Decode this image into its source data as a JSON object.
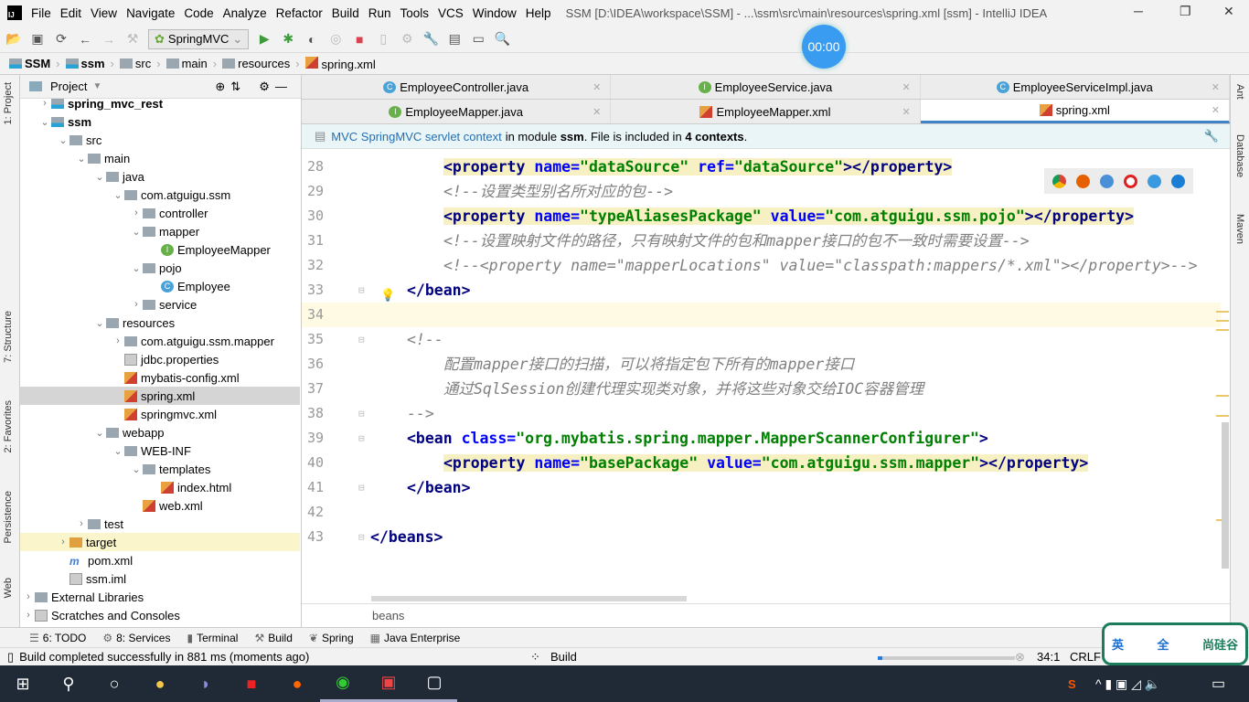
{
  "window": {
    "title": "SSM [D:\\IDEA\\workspace\\SSM] - ...\\ssm\\src\\main\\resources\\spring.xml [ssm] - IntelliJ IDEA",
    "logo": "IJ"
  },
  "menu": [
    "File",
    "Edit",
    "View",
    "Navigate",
    "Code",
    "Analyze",
    "Refactor",
    "Build",
    "Run",
    "Tools",
    "VCS",
    "Window",
    "Help"
  ],
  "toolbar": {
    "run_config": "SpringMVC",
    "timer": "00:00"
  },
  "breadcrumb": [
    "SSM",
    "ssm",
    "src",
    "main",
    "resources",
    "spring.xml"
  ],
  "left_strip": [
    "1: Project",
    "7: Structure",
    "2: Favorites",
    "Persistence",
    "Web"
  ],
  "right_strip": [
    "Ant",
    "Database",
    "Maven"
  ],
  "project": {
    "header": "Project",
    "tree": [
      {
        "label": "spring_mvc_rest",
        "level": 0,
        "icon": "module",
        "arrow": "right",
        "bold": true
      },
      {
        "label": "ssm",
        "level": 0,
        "icon": "module",
        "arrow": "down",
        "bold": true
      },
      {
        "label": "src",
        "level": 1,
        "icon": "folder",
        "arrow": "down"
      },
      {
        "label": "main",
        "level": 2,
        "icon": "folder",
        "arrow": "down"
      },
      {
        "label": "java",
        "level": 3,
        "icon": "src-folder",
        "arrow": "down"
      },
      {
        "label": "com.atguigu.ssm",
        "level": 4,
        "icon": "package",
        "arrow": "down"
      },
      {
        "label": "controller",
        "level": 5,
        "icon": "package",
        "arrow": "right"
      },
      {
        "label": "mapper",
        "level": 5,
        "icon": "package",
        "arrow": "down"
      },
      {
        "label": "EmployeeMapper",
        "level": 6,
        "icon": "interface"
      },
      {
        "label": "pojo",
        "level": 5,
        "icon": "package",
        "arrow": "down"
      },
      {
        "label": "Employee",
        "level": 6,
        "icon": "class"
      },
      {
        "label": "service",
        "level": 5,
        "icon": "package",
        "arrow": "right"
      },
      {
        "label": "resources",
        "level": 3,
        "icon": "res-folder",
        "arrow": "down"
      },
      {
        "label": "com.atguigu.ssm.mapper",
        "level": 4,
        "icon": "package",
        "arrow": "right"
      },
      {
        "label": "jdbc.properties",
        "level": 4,
        "icon": "file"
      },
      {
        "label": "mybatis-config.xml",
        "level": 4,
        "icon": "xml"
      },
      {
        "label": "spring.xml",
        "level": 4,
        "icon": "xml",
        "selected": true
      },
      {
        "label": "springmvc.xml",
        "level": 4,
        "icon": "xml"
      },
      {
        "label": "webapp",
        "level": 3,
        "icon": "folder",
        "arrow": "down"
      },
      {
        "label": "WEB-INF",
        "level": 4,
        "icon": "folder",
        "arrow": "down"
      },
      {
        "label": "templates",
        "level": 5,
        "icon": "folder",
        "arrow": "down"
      },
      {
        "label": "index.html",
        "level": 6,
        "icon": "html"
      },
      {
        "label": "web.xml",
        "level": 5,
        "icon": "xml"
      },
      {
        "label": "test",
        "level": 2,
        "icon": "folder",
        "arrow": "right"
      },
      {
        "label": "target",
        "level": 1,
        "icon": "folder-orange",
        "arrow": "right",
        "highlight": true
      },
      {
        "label": "pom.xml",
        "level": 1,
        "icon": "pom"
      },
      {
        "label": "ssm.iml",
        "level": 1,
        "icon": "file"
      },
      {
        "label": "External Libraries",
        "level": -1,
        "icon": "libs",
        "arrow": "right"
      },
      {
        "label": "Scratches and Consoles",
        "level": -1,
        "icon": "scratches",
        "arrow": "right"
      }
    ]
  },
  "tabs_row1": [
    {
      "label": "EmployeeController.java",
      "icon": "C"
    },
    {
      "label": "EmployeeService.java",
      "icon": "I"
    },
    {
      "label": "EmployeeServiceImpl.java",
      "icon": "C"
    }
  ],
  "tabs_row2": [
    {
      "label": "EmployeeMapper.java",
      "icon": "I"
    },
    {
      "label": "EmployeeMapper.xml",
      "icon": "xml"
    },
    {
      "label": "spring.xml",
      "icon": "xml",
      "active": true
    }
  ],
  "banner": {
    "link": "MVC SpringMVC servlet context",
    "t1": "in module",
    "module": "ssm",
    "t2": ". File is included in",
    "count": "4 contexts",
    "t3": "."
  },
  "code": [
    {
      "n": "28",
      "indent": 8,
      "tokens": [
        [
          "tag",
          "<property "
        ],
        [
          "attr",
          "name="
        ],
        [
          "val",
          "\"dataSource\" "
        ],
        [
          "attr",
          "ref="
        ],
        [
          "val",
          "\"dataSource\""
        ],
        [
          "tag",
          "></property>"
        ]
      ],
      "hl": true
    },
    {
      "n": "29",
      "indent": 8,
      "tokens": [
        [
          "com",
          "<!--设置类型别名所对应的包-->"
        ]
      ]
    },
    {
      "n": "30",
      "indent": 8,
      "tokens": [
        [
          "tag",
          "<property "
        ],
        [
          "attr",
          "name="
        ],
        [
          "val",
          "\"typeAliasesPackage\" "
        ],
        [
          "attr",
          "value="
        ],
        [
          "val",
          "\"com.atguigu.ssm.pojo\""
        ],
        [
          "tag",
          "></property>"
        ]
      ],
      "hl": true
    },
    {
      "n": "31",
      "indent": 8,
      "tokens": [
        [
          "com",
          "<!--设置映射文件的路径，只有映射文件的包和mapper接口的包不一致时需要设置-->"
        ]
      ]
    },
    {
      "n": "32",
      "indent": 8,
      "tokens": [
        [
          "com",
          "<!--<property name=\"mapperLocations\" value=\"classpath:mappers/*.xml\"></property>-->"
        ]
      ]
    },
    {
      "n": "33",
      "indent": 4,
      "tokens": [
        [
          "tag",
          "</bean>"
        ]
      ]
    },
    {
      "n": "34",
      "indent": 0,
      "tokens": [],
      "current": true
    },
    {
      "n": "35",
      "indent": 4,
      "tokens": [
        [
          "com",
          "<!--"
        ]
      ]
    },
    {
      "n": "36",
      "indent": 8,
      "tokens": [
        [
          "com",
          "配置mapper接口的扫描，可以将指定包下所有的mapper接口"
        ]
      ]
    },
    {
      "n": "37",
      "indent": 8,
      "tokens": [
        [
          "com",
          "通过SqlSession创建代理实现类对象，并将这些对象交给IOC容器管理"
        ]
      ]
    },
    {
      "n": "38",
      "indent": 4,
      "tokens": [
        [
          "com",
          "-->"
        ]
      ]
    },
    {
      "n": "39",
      "indent": 4,
      "tokens": [
        [
          "tag",
          "<bean "
        ],
        [
          "attr",
          "class="
        ],
        [
          "val",
          "\"org.mybatis.spring.mapper.MapperScannerConfigurer\""
        ],
        [
          "tag",
          ">"
        ]
      ]
    },
    {
      "n": "40",
      "indent": 8,
      "tokens": [
        [
          "tag",
          "<property "
        ],
        [
          "attr",
          "name="
        ],
        [
          "val",
          "\"basePackage\" "
        ],
        [
          "attr",
          "value="
        ],
        [
          "val",
          "\"com.atguigu.ssm.mapper\""
        ],
        [
          "tag",
          "></property>"
        ]
      ],
      "hl": true
    },
    {
      "n": "41",
      "indent": 4,
      "tokens": [
        [
          "tag",
          "</bean>"
        ]
      ]
    },
    {
      "n": "42",
      "indent": 0,
      "tokens": []
    },
    {
      "n": "43",
      "indent": 0,
      "tokens": [
        [
          "tag",
          "</beans>"
        ]
      ]
    }
  ],
  "editor_footer": "beans",
  "tool_tabs": [
    "6: TODO",
    "8: Services",
    "Terminal",
    "Build",
    "Spring",
    "Java Enterprise"
  ],
  "status": {
    "message": "Build completed successfully in 881 ms (moments ago)",
    "task": "Build",
    "position": "34:1",
    "line_sep": "CRLF"
  },
  "ime": {
    "lang": "英",
    "mode": "全",
    "brand": "尚硅谷"
  },
  "colors": {
    "accent": "#4083c9",
    "tag": "#000080",
    "attr": "#0000ff",
    "value": "#008000",
    "comment": "#808080"
  }
}
